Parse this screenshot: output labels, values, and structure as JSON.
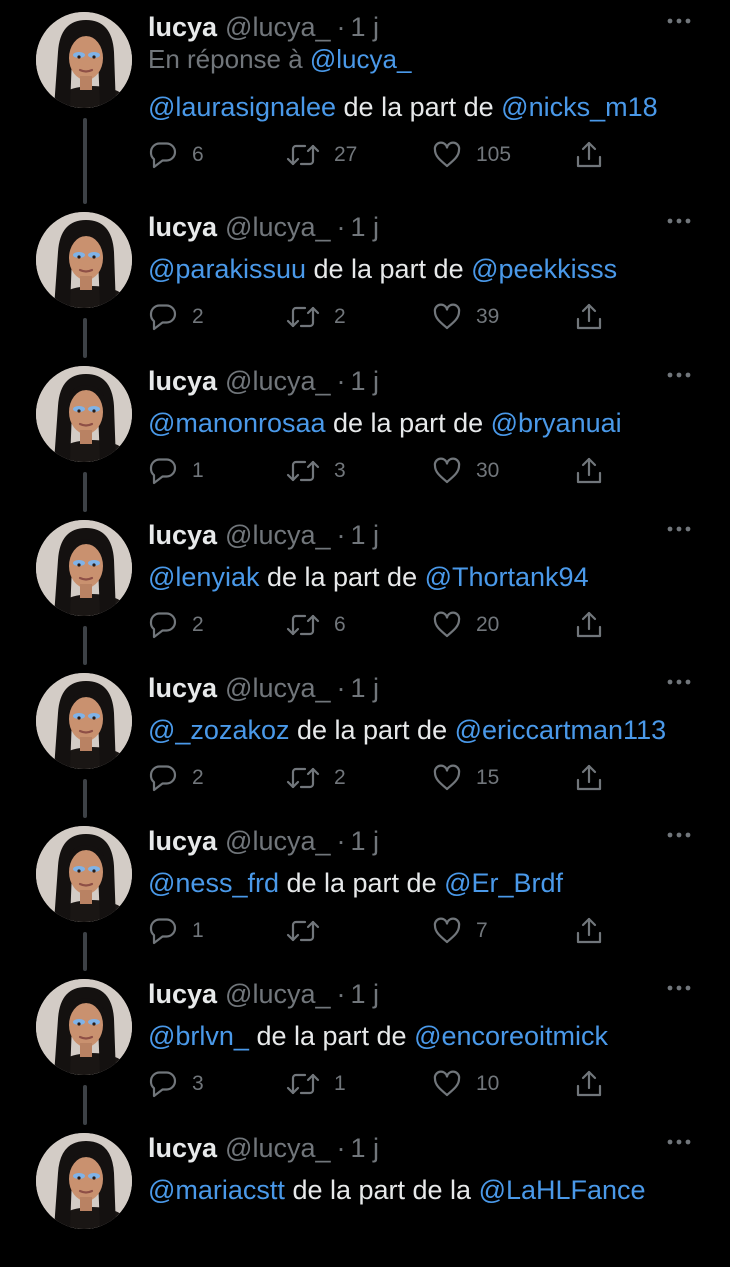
{
  "colors": {
    "background": "#000000",
    "text": "#e7e9ea",
    "secondary": "#71767b",
    "mention": "#4a99e9",
    "thread_line": "#3d4146"
  },
  "tweets": [
    {
      "name": "lucya",
      "handle": "@lucya_",
      "separator": "·",
      "time": "1 j",
      "reply_prefix": "En réponse à",
      "reply_mention": "@lucya_",
      "mention": "@laurasignalee",
      "middle": "de la part de",
      "via": "@nicks_m18",
      "replies": "6",
      "retweets": "27",
      "likes": "105"
    },
    {
      "name": "lucya",
      "handle": "@lucya_",
      "separator": "·",
      "time": "1 j",
      "mention": "@parakissuu",
      "middle": "de la part de",
      "via": "@peekkisss",
      "replies": "2",
      "retweets": "2",
      "likes": "39"
    },
    {
      "name": "lucya",
      "handle": "@lucya_",
      "separator": "·",
      "time": "1 j",
      "mention": "@manonrosaa",
      "middle": "de la part de",
      "via": "@bryanuai",
      "replies": "1",
      "retweets": "3",
      "likes": "30"
    },
    {
      "name": "lucya",
      "handle": "@lucya_",
      "separator": "·",
      "time": "1 j",
      "mention": "@lenyiak",
      "middle": "de la part de",
      "via": "@Thortank94",
      "replies": "2",
      "retweets": "6",
      "likes": "20"
    },
    {
      "name": "lucya",
      "handle": "@lucya_",
      "separator": "·",
      "time": "1 j",
      "mention": "@_zozakoz",
      "middle": "de la part de",
      "via": "@ericcartman113",
      "replies": "2",
      "retweets": "2",
      "likes": "15"
    },
    {
      "name": "lucya",
      "handle": "@lucya_",
      "separator": "·",
      "time": "1 j",
      "mention": "@ness_frd",
      "middle": "de la part de",
      "via": "@Er_Brdf",
      "replies": "1",
      "retweets": "",
      "likes": "7"
    },
    {
      "name": "lucya",
      "handle": "@lucya_",
      "separator": "·",
      "time": "1 j",
      "mention": "@brlvn_",
      "middle": "de la part de",
      "via": "@encoreoitmick",
      "replies": "3",
      "retweets": "1",
      "likes": "10"
    },
    {
      "name": "lucya",
      "handle": "@lucya_",
      "separator": "·",
      "time": "1 j",
      "mention": "@mariacstt",
      "middle": "de la part de la",
      "via": "@LaHLFance",
      "replies": "",
      "retweets": "",
      "likes": ""
    }
  ],
  "icons": {
    "reply": "reply-icon",
    "retweet": "retweet-icon",
    "like": "heart-icon",
    "share": "share-icon",
    "more": "more-options-icon"
  }
}
